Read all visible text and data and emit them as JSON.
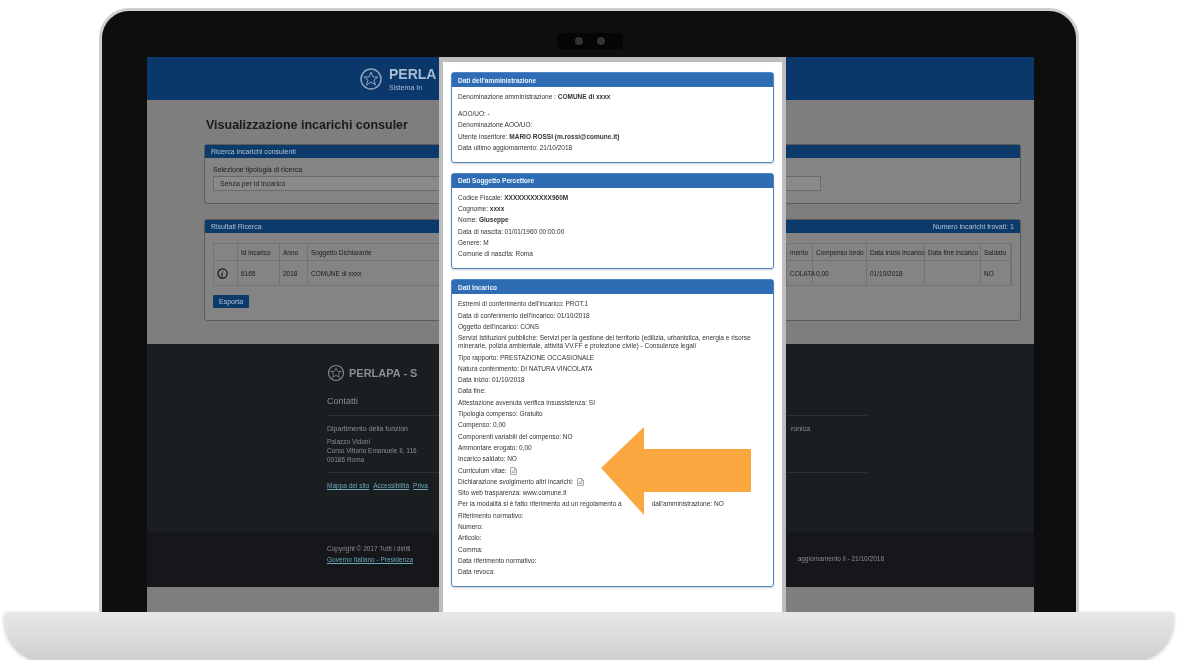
{
  "page": {
    "header": {
      "brand": "PERLA",
      "subtitle": "Sistema In"
    },
    "title": "Visualizzazione incarichi consuler",
    "search_panel": {
      "title": "Ricerca incarichi consulenti",
      "label": "Selezione tipologia di ricerca",
      "select_value": "Senza per id incarico"
    },
    "results_panel": {
      "title": "Risultati Ricerca",
      "count": "Numero incarichi trovati: 1",
      "columns": [
        "Id incarico",
        "Anno",
        "Soggetto Dichiarante",
        "mento",
        "Compenso lordo",
        "Data inizio incarico",
        "Data fine incarico",
        "Saldato"
      ],
      "rows": [
        {
          "cells": [
            "6165",
            "2018",
            "COMUNE di xxxx",
            "COLATA",
            "0,00",
            "01/10/2018",
            null,
            "NO"
          ]
        }
      ],
      "export_button": "Esporta"
    },
    "footer": {
      "brand": "PERLAPA - S",
      "contacts_title": "Contatti",
      "department": "Dipartimento della funzion",
      "column_2_heading": "ronica",
      "address": [
        "Palazzo Vidoni",
        "Corso Vittorio Emanuele II, 116",
        "00186 Roma"
      ],
      "links": [
        "Mappa del sito",
        "Accessibilità",
        "Priva"
      ],
      "copyright": "Copyright © 2017 Tutti i diritti",
      "government_link": "Governo Italiano - Presidenza",
      "update_note": "aggiornamento il - 21/10/2018"
    }
  },
  "dialog": {
    "sections": [
      {
        "title": "Dati dell'amministrazione",
        "groups": [
          [
            {
              "kind": "text",
              "text": "Denominazione amministrazione :   **COMUNE di xxxx**"
            }
          ],
          [
            {
              "kind": "text",
              "text": "AOO/UO: -"
            },
            {
              "kind": "text",
              "text": "Denominazione AOO/UO:"
            },
            {
              "kind": "text",
              "text": "Utente inseritore:  **MARIO ROSSI (m.rossi@comune.it)**"
            },
            {
              "kind": "text",
              "text": "Data ultimo aggiornamento: 21/10/2018"
            }
          ]
        ]
      },
      {
        "title": "Dati Soggetto Percettore",
        "groups": [
          [
            {
              "kind": "text",
              "text": "Codice Fiscale:   **XXXXXXXXXXX960M**"
            },
            {
              "kind": "text",
              "text": "Cognome:  **xxxx**"
            },
            {
              "kind": "text",
              "text": "Nome:  **Giuseppe**"
            },
            {
              "kind": "text",
              "text": "Data di nascita: 01/01/1960 00:00:00"
            },
            {
              "kind": "text",
              "text": "Genere: M"
            },
            {
              "kind": "text",
              "text": "Comune di nascita: Roma"
            }
          ]
        ]
      },
      {
        "title": "Dati Incarico",
        "groups": [
          [
            {
              "kind": "text",
              "text": "Estremi di conferimento dell'incarico: PROT.1"
            },
            {
              "kind": "text",
              "text": "Data di conferimento dell'incarico: 01/10/2018"
            },
            {
              "kind": "text",
              "text": "Oggetto dell'incarico: CONS"
            },
            {
              "kind": "text",
              "text": "Servizi Istituzioni pubbliche: Servizi per la gestione del territorio (edilizia, urbanistica, energia e risorse minerarie, polizia ambientale, attività VV.FF e protezione civile) - Consulenze legali"
            },
            {
              "kind": "text",
              "text": "Tipo rapporto: PRESTAZIONE OCCASIONALE"
            },
            {
              "kind": "text",
              "text": "Natura conferimento: DI NATURA VINCOLATA"
            },
            {
              "kind": "text",
              "text": "Data inizio: 01/10/2018"
            },
            {
              "kind": "text",
              "text": "Data fine:"
            },
            {
              "kind": "text",
              "text": "Attestazione avvenuta verifica insussistenza: SI"
            },
            {
              "kind": "text",
              "text": "Tipologia compenso: Gratuito"
            },
            {
              "kind": "text",
              "text": "Compenso: 0,00"
            },
            {
              "kind": "text",
              "text": "Componenti variabili del compenso: NO"
            },
            {
              "kind": "text",
              "text": "Ammontare erogato: 0,00"
            },
            {
              "kind": "text",
              "text": "Incarico saldato: NO"
            },
            {
              "kind": "file",
              "text": "Curriculum vitae:"
            },
            {
              "kind": "file",
              "text": "Dichiarazione svolgimento altri incarichi:"
            },
            {
              "kind": "text",
              "text": "Sito web trasparenza:   www.comune.it"
            },
            {
              "kind": "covered",
              "parts": [
                "Per la modalità si è fatto riferimento ad un regolamento a",
                "dall'amministrazione: NO"
              ]
            },
            {
              "kind": "text",
              "text": "Riferimento normativo:"
            },
            {
              "kind": "text",
              "text": "Numero:"
            },
            {
              "kind": "text",
              "text": "Articolo:"
            },
            {
              "kind": "text",
              "text": "Comma:"
            },
            {
              "kind": "text",
              "text": "Data riferimento normativo:"
            },
            {
              "kind": "text",
              "text": "Data revoca:"
            }
          ]
        ]
      }
    ]
  }
}
